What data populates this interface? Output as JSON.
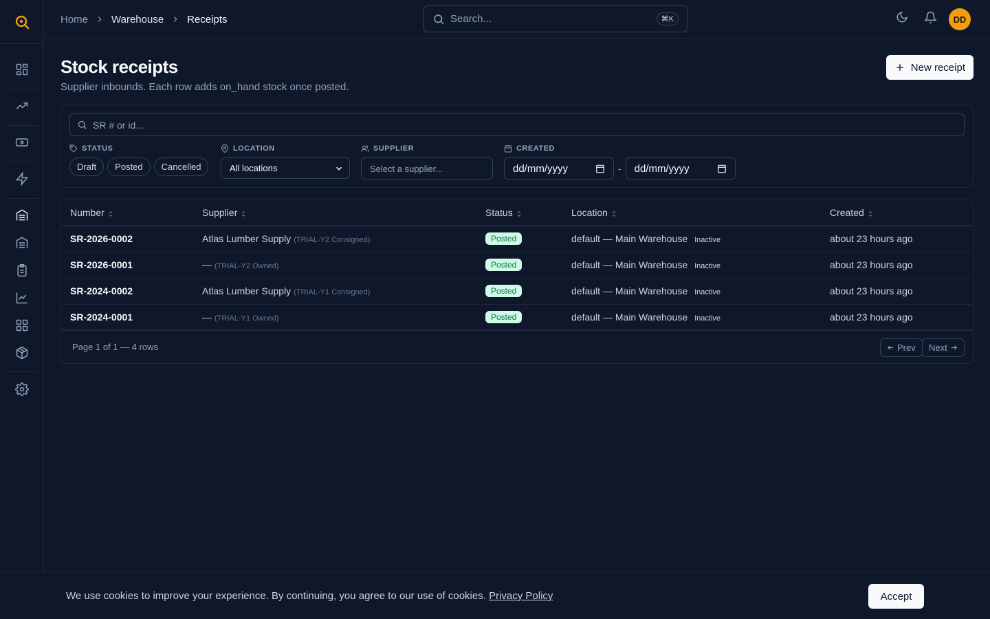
{
  "breadcrumb": {
    "home": "Home",
    "section": "Warehouse",
    "current": "Receipts"
  },
  "search": {
    "placeholder": "Search...",
    "shortcut": "⌘K"
  },
  "user": {
    "initials": "DD"
  },
  "page": {
    "title": "Stock receipts",
    "subtitle": "Supplier inbounds. Each row adds on_hand stock once posted.",
    "new_button": "New receipt"
  },
  "filters": {
    "search_placeholder": "SR # or id...",
    "status_label": "STATUS",
    "status_options": [
      "Draft",
      "Posted",
      "Cancelled"
    ],
    "location_label": "LOCATION",
    "location_value": "All locations",
    "supplier_label": "SUPPLIER",
    "supplier_placeholder": "Select a supplier...",
    "created_label": "CREATED",
    "date_from": "dd/mm/yyyy",
    "date_to": "dd/mm/yyyy",
    "date_sep": "-"
  },
  "table": {
    "headers": [
      "Number",
      "Supplier",
      "Status",
      "Location",
      "Created"
    ],
    "rows": [
      {
        "number": "SR-2026-0002",
        "supplier": "Atlas Lumber Supply",
        "supplier_tag": "(TRIAL-Y2 Consigned)",
        "status": "Posted",
        "location": "default — Main Warehouse",
        "location_state": "Inactive",
        "created": "about 23 hours ago"
      },
      {
        "number": "SR-2026-0001",
        "supplier": "—",
        "supplier_tag": "(TRIAL-Y2 Owned)",
        "status": "Posted",
        "location": "default — Main Warehouse",
        "location_state": "Inactive",
        "created": "about 23 hours ago"
      },
      {
        "number": "SR-2024-0002",
        "supplier": "Atlas Lumber Supply",
        "supplier_tag": "(TRIAL-Y1 Consigned)",
        "status": "Posted",
        "location": "default — Main Warehouse",
        "location_state": "Inactive",
        "created": "about 23 hours ago"
      },
      {
        "number": "SR-2024-0001",
        "supplier": "—",
        "supplier_tag": "(TRIAL-Y1 Owned)",
        "status": "Posted",
        "location": "default — Main Warehouse",
        "location_state": "Inactive",
        "created": "about 23 hours ago"
      }
    ]
  },
  "pagination": {
    "text": "Page 1 of 1 — 4 rows",
    "prev": "Prev",
    "next": "Next"
  },
  "cookie": {
    "text": "We use cookies to improve your experience. By continuing, you agree to our use of cookies.",
    "link": "Privacy Policy",
    "accept": "Accept"
  },
  "colors": {
    "accent": "#f59e0b",
    "posted_bg": "#d1fae5",
    "posted_text": "#047857",
    "background": "#0f172a"
  }
}
